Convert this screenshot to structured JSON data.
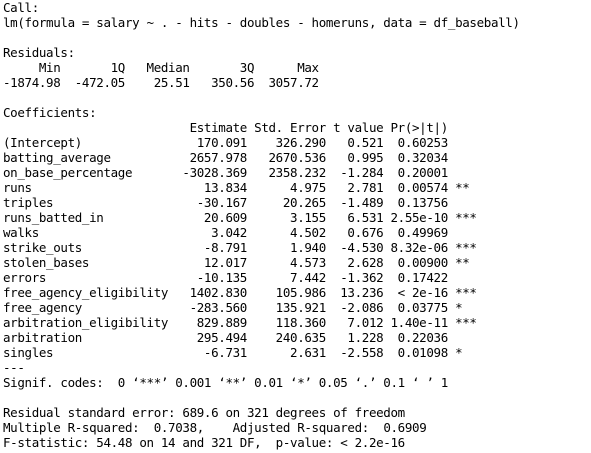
{
  "console": {
    "lines": [
      "Call:",
      "lm(formula = salary ~ . - hits - doubles - homeruns, data = df_baseball)",
      "",
      "Residuals:",
      "     Min       1Q   Median       3Q      Max ",
      "-1874.98  -472.05    25.51   350.56  3057.72 ",
      "",
      "Coefficients:",
      "                          Estimate Std. Error t value Pr(>|t|)    ",
      "(Intercept)                170.091    326.290   0.521  0.60253    ",
      "batting_average           2657.978   2670.536   0.995  0.32034    ",
      "on_base_percentage       -3028.369   2358.232  -1.284  0.20001    ",
      "runs                        13.834      4.975   2.781  0.00574 ** ",
      "triples                    -30.167     20.265  -1.489  0.13756    ",
      "runs_batted_in              20.609      3.155   6.531 2.55e-10 ***",
      "walks                        3.042      4.502   0.676  0.49969    ",
      "strike_outs                 -8.791      1.940  -4.530 8.32e-06 ***",
      "stolen_bases                12.017      4.573   2.628  0.00900 ** ",
      "errors                     -10.135      7.442  -1.362  0.17422    ",
      "free_agency_eligibility   1402.830    105.986  13.236  < 2e-16 ***",
      "free_agency               -283.560    135.921  -2.086  0.03775 *  ",
      "arbitration_eligibility    829.889    118.360   7.012 1.40e-11 ***",
      "arbitration                295.494    240.635   1.228  0.22036    ",
      "singles                     -6.731      2.631  -2.558  0.01098 *  ",
      "---",
      "Signif. codes:  0 ‘***’ 0.001 ‘**’ 0.01 ‘*’ 0.05 ‘.’ 0.1 ‘ ’ 1",
      "",
      "Residual standard error: 689.6 on 321 degrees of freedom",
      "Multiple R-squared:  0.7038,\tAdjusted R-squared:  0.6909 ",
      "F-statistic: 54.48 on 14 and 321 DF,  p-value: < 2.2e-16"
    ]
  }
}
